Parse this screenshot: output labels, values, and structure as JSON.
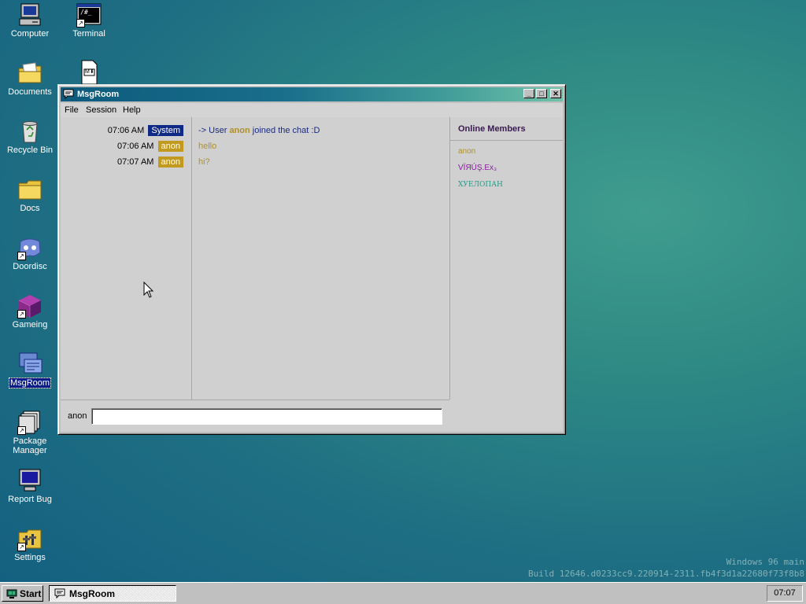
{
  "desktop": {
    "icons": [
      {
        "label": "Computer",
        "icon": "computer-icon"
      },
      {
        "label": "Terminal",
        "icon": "terminal-icon"
      },
      {
        "label": "Documents",
        "icon": "documents-folder-icon"
      },
      {
        "label": "Recycle Bin",
        "icon": "recycle-bin-icon"
      },
      {
        "label": "Docs",
        "icon": "folder-icon"
      },
      {
        "label": "Doordisc",
        "icon": "doordisc-icon"
      },
      {
        "label": "Gameing",
        "icon": "cube-icon"
      },
      {
        "label": "MsgRoom",
        "icon": "msgroom-icon"
      },
      {
        "label": "Package Manager",
        "icon": "package-icon"
      },
      {
        "label": "Report Bug",
        "icon": "monitor-icon"
      },
      {
        "label": "Settings",
        "icon": "settings-icon"
      },
      {
        "label": "",
        "icon": "markdown-file-icon"
      }
    ],
    "markdown_glyph": "M⬇"
  },
  "window": {
    "title": "MsgRoom",
    "menu": [
      "File",
      "Session",
      "Help"
    ],
    "buttons": {
      "minimize": "_",
      "maximize": "□",
      "close": "✕"
    }
  },
  "messages": [
    {
      "time": "07:06 AM",
      "user": "System",
      "tag_color": "#0f2a86",
      "parts": [
        "-> User ",
        "anon",
        " joined the chat :D"
      ],
      "text_color": "#1a2a80"
    },
    {
      "time": "07:06 AM",
      "user": "anon",
      "tag_color": "#c29a1f",
      "text": "hello",
      "text_color": "#b0902a"
    },
    {
      "time": "07:07 AM",
      "user": "anon",
      "tag_color": "#c29a1f",
      "text": "hi?",
      "text_color": "#b0902a"
    }
  ],
  "members": {
    "heading": "Online Members",
    "list": [
      {
        "name": "anon",
        "color": "#b0902a"
      },
      {
        "name": "VÏЯÚŞ.Ex₃",
        "color": "#8a1aa0"
      },
      {
        "name": "ХУЕЛОПАН",
        "color": "#2a9a88"
      }
    ]
  },
  "input": {
    "label": "anon",
    "value": "",
    "placeholder": ""
  },
  "taskbar": {
    "start_label": "Start",
    "task_label": "MsgRoom",
    "clock": "07:07"
  },
  "watermark": {
    "line1": "Windows 96 main",
    "line2": "Build 12646.d0233cc9.220914-2311.fb4f3d1a22680f73f8b8"
  }
}
